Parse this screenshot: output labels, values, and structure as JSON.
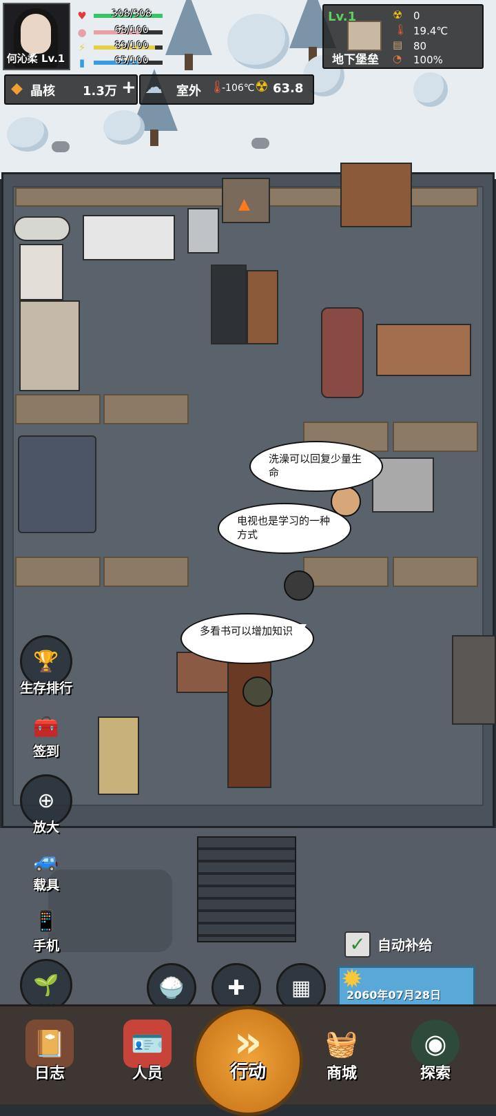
{
  "player": {
    "name_level": "何沁柔 Lv.1"
  },
  "stats": [
    {
      "icon": "heart-icon",
      "text": "308/308",
      "value": 1.0,
      "color": "#39c46a"
    },
    {
      "icon": "stomach-icon",
      "text": "68/100",
      "value": 0.68,
      "color": "#e8a0a8"
    },
    {
      "icon": "energy-icon",
      "text": "89/100",
      "value": 0.89,
      "color": "#e6d04a"
    },
    {
      "icon": "water-icon",
      "text": "65/100",
      "value": 0.65,
      "color": "#3a9be0"
    }
  ],
  "currency": {
    "label": "晶核",
    "amount": "1.3万",
    "add_symbol": "+"
  },
  "outside": {
    "label": "室外",
    "temperature": "-106℃",
    "radiation": "63.8"
  },
  "base": {
    "level": "Lv.1",
    "name": "地下堡垒",
    "radiation": "0",
    "temperature": "19.4℃",
    "materials": "80",
    "integrity": "100%"
  },
  "bubbles": [
    "洗澡可以回复少量生命",
    "电视也是学习的一种方式",
    "多看书可以增加知识"
  ],
  "side_buttons": [
    "生存排行",
    "签到",
    "放大",
    "载具",
    "手机",
    "种植"
  ],
  "facilities": [
    "烹饪",
    "医疗",
    "仓库"
  ],
  "auto_supply": {
    "label": "自动补给",
    "checked": true
  },
  "date": "2060年07月28日",
  "nav": {
    "log": "日志",
    "people": "人员",
    "action": "行动",
    "shop": "商城",
    "explore": "探索"
  }
}
